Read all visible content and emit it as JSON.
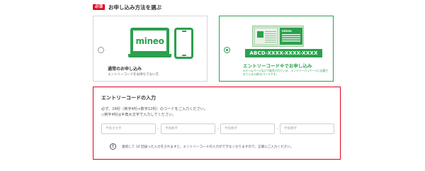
{
  "section": {
    "badge": "必須",
    "title": "お申し込み方法を選ぶ"
  },
  "options": [
    {
      "title": "通常のお申し込み",
      "subtitle": "エントリーコードをお持ちでない方",
      "logo": "mineo",
      "selected": false
    },
    {
      "title": "エントリーコード※でお申し込み",
      "subtitle": "※ホームページなどで販売されている、エントリーパッケージに記載されている16桁のコードです。",
      "code_example": "ABCD-XXXX-XXXX-XXXX",
      "package_brand": "mineo",
      "selected": true
    }
  ],
  "entry": {
    "title": "エントリーコードの入力",
    "instruction_1": "必ず、16桁（英字4桁+数字12桁）のコードをご入力ください。",
    "instruction_2": "◇英字4桁は半角大文字で入力してください。",
    "inputs": [
      {
        "placeholder": "半角大文字",
        "value": ""
      },
      {
        "placeholder": "半角数字",
        "value": ""
      },
      {
        "placeholder": "半角数字",
        "value": ""
      },
      {
        "placeholder": "半角数字",
        "value": ""
      }
    ],
    "separator": "-",
    "notice_icon": "!",
    "notice": "連続して 10 回誤った入力をされますと、エントリーコードの入力ができなくなりますので、正確にご入力ください。"
  },
  "colors": {
    "accent": "#2ba04e",
    "required": "#e3001b"
  }
}
